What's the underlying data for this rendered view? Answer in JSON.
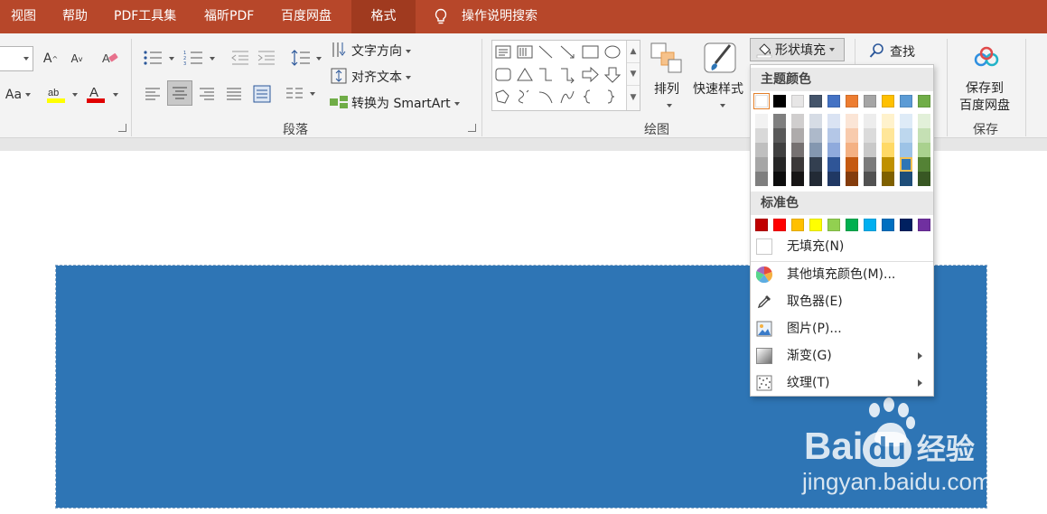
{
  "tabs": [
    {
      "label": "视图"
    },
    {
      "label": "帮助"
    },
    {
      "label": "PDF工具集"
    },
    {
      "label": "福昕PDF"
    },
    {
      "label": "百度网盘"
    },
    {
      "label": "格式",
      "active": true
    }
  ],
  "tell_me": "操作说明搜索",
  "ribbon": {
    "font_size_value": "",
    "font_case_label": "Aa",
    "paragraph": {
      "text_direction": "文字方向",
      "align_text": "对齐文本",
      "convert_smartart": "转换为 SmartArt",
      "group_label": "段落"
    },
    "drawing": {
      "arrange": "排列",
      "quick_styles": "快速样式",
      "shape_fill": "形状填充",
      "group_label": "绘图"
    },
    "editing": {
      "find": "查找"
    },
    "save": {
      "save_line1": "保存到",
      "save_line2": "百度网盘",
      "group_label": "保存"
    }
  },
  "fill_menu": {
    "theme_colors_header": "主题颜色",
    "theme_colors_top": [
      "#ffffff",
      "#000000",
      "#e7e6e6",
      "#44546a",
      "#4472c4",
      "#ed7d31",
      "#a5a5a5",
      "#ffc000",
      "#5b9bd5",
      "#70ad47"
    ],
    "theme_shades": [
      [
        "#f2f2f2",
        "#7f7f7f",
        "#d0cece",
        "#d6dce5",
        "#dae3f3",
        "#fbe5d6",
        "#ededed",
        "#fff2cc",
        "#deebf7",
        "#e2f0d9"
      ],
      [
        "#d9d9d9",
        "#595959",
        "#aeabab",
        "#adb9ca",
        "#b4c7e7",
        "#f8cbad",
        "#dbdbdb",
        "#ffe699",
        "#bdd7ee",
        "#c5e0b4"
      ],
      [
        "#bfbfbf",
        "#404040",
        "#767171",
        "#8497b0",
        "#8faadc",
        "#f4b183",
        "#c9c9c9",
        "#ffd966",
        "#9dc3e6",
        "#a9d18e"
      ],
      [
        "#a6a6a6",
        "#262626",
        "#3b3838",
        "#333f50",
        "#2f5597",
        "#c55a11",
        "#7b7b7b",
        "#bf9000",
        "#2e75b6",
        "#548235"
      ],
      [
        "#7f7f7f",
        "#0d0d0d",
        "#171515",
        "#222a35",
        "#203864",
        "#843c0c",
        "#525252",
        "#7f6000",
        "#1f4e79",
        "#385723"
      ]
    ],
    "standard_colors_header": "标准色",
    "standard_colors": [
      "#c00000",
      "#ff0000",
      "#ffc000",
      "#ffff00",
      "#92d050",
      "#00b050",
      "#00b0f0",
      "#0070c0",
      "#002060",
      "#7030a0"
    ],
    "items": [
      {
        "label": "无填充(N)",
        "icon": "no-fill-icon"
      },
      {
        "label": "其他填充颜色(M)...",
        "icon": "color-wheel-icon"
      },
      {
        "label": "取色器(E)",
        "icon": "eyedropper-icon"
      },
      {
        "label": "图片(P)...",
        "icon": "picture-icon"
      },
      {
        "label": "渐变(G)",
        "icon": "gradient-icon",
        "submenu": true
      },
      {
        "label": "纹理(T)",
        "icon": "texture-icon",
        "submenu": true
      }
    ]
  },
  "shape_color": "#2e75b5",
  "watermark": {
    "brand": "Bai",
    "brand_du": "du",
    "brand_cn": "经验",
    "url": "jingyan.baidu.com"
  }
}
